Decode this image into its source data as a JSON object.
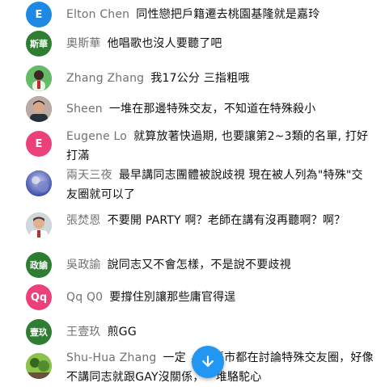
{
  "chat": {
    "messages": [
      {
        "author": "Elton Chen",
        "text": "同性戀把戶籍遷去桃園基隆就是嘉玲",
        "avatar_text": "E",
        "avatar_color": "#1e88e5"
      },
      {
        "author": "奧斯華",
        "text": "他唱歌也沒人要聽了吧",
        "avatar_text": "斯華",
        "avatar_color": "#2e7d32"
      },
      {
        "author": "Zhang Zhang",
        "text": "我17公分 三指粗哦",
        "avatar_text": "",
        "avatar_color": "#4caf50"
      },
      {
        "author": "Sheen",
        "text": "一堆在那邊特殊交友，不知道在特殊殺小",
        "avatar_text": "",
        "avatar_color": "#5d4037"
      },
      {
        "author": "Eugene Lo",
        "text": "就算放著快過期, 也要讓第2~3類的名單, 打好打滿",
        "avatar_text": "E",
        "avatar_color": "#ec407a"
      },
      {
        "author": "兩天三夜",
        "text": "最早講同志團體被說歧視 現在被人列為\"特殊\"交友圈就可以了",
        "avatar_text": "",
        "avatar_color": "#5c6bc0"
      },
      {
        "author": "張焚恩",
        "text": "不要開 PARTY 啊？老師在講有沒再聽啊？啊？",
        "avatar_text": "",
        "avatar_color": "#90a4ae"
      },
      {
        "author": "吳政諭",
        "text": "說同志又不會怎樣，不是說不要歧視",
        "avatar_text": "政諭",
        "avatar_color": "#2e7d32"
      },
      {
        "author": "Qq Q0",
        "text": "要撐住別讓那些庸官得逞",
        "avatar_text": "Qq",
        "avatar_color": "#ec407a"
      },
      {
        "author": "王壹玖",
        "text": "煎GG",
        "avatar_text": "壹玖",
        "avatar_color": "#2e7d32"
      },
      {
        "author": "Shu-Hua Zhang",
        "text": "一定    ，各縣市都在討論特殊交友圈，好像不講同志就跟GAY沒關係，一堆駱駝心",
        "avatar_text": "",
        "avatar_color": "#689f38"
      }
    ]
  },
  "scroll_button": {
    "icon": "arrow-down-icon",
    "color": "#2196f3"
  }
}
